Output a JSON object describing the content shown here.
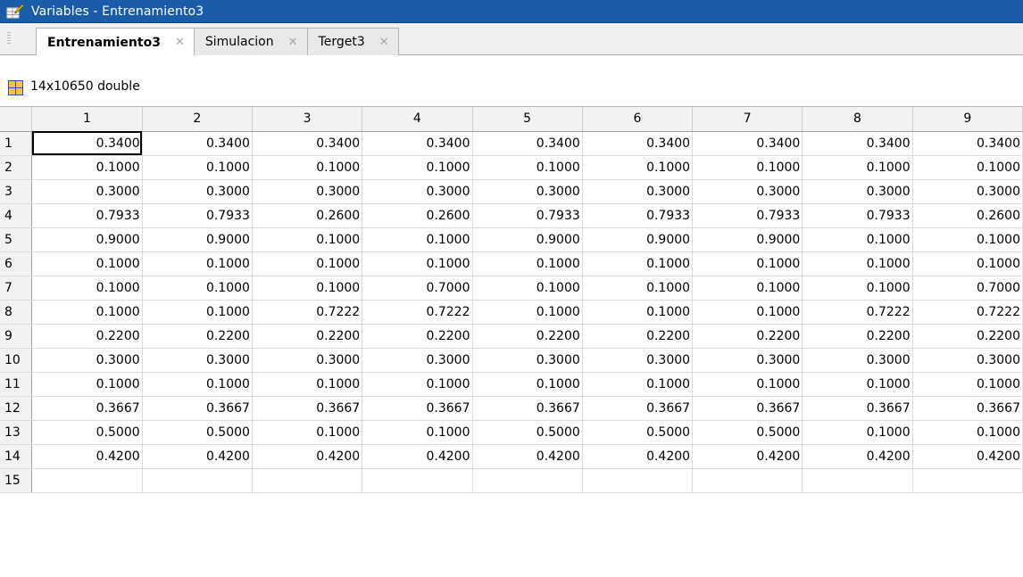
{
  "window": {
    "title": "Variables - Entrenamiento3"
  },
  "tabs": [
    {
      "label": "Entrenamiento3",
      "active": true
    },
    {
      "label": "Simulacion",
      "active": false
    },
    {
      "label": "Terget3",
      "active": false
    }
  ],
  "variable": {
    "info": "14x10650 double"
  },
  "table": {
    "columns": [
      "1",
      "2",
      "3",
      "4",
      "5",
      "6",
      "7",
      "8",
      "9"
    ],
    "rows": [
      {
        "label": "1",
        "values": [
          "0.3400",
          "0.3400",
          "0.3400",
          "0.3400",
          "0.3400",
          "0.3400",
          "0.3400",
          "0.3400",
          "0.3400"
        ]
      },
      {
        "label": "2",
        "values": [
          "0.1000",
          "0.1000",
          "0.1000",
          "0.1000",
          "0.1000",
          "0.1000",
          "0.1000",
          "0.1000",
          "0.1000"
        ]
      },
      {
        "label": "3",
        "values": [
          "0.3000",
          "0.3000",
          "0.3000",
          "0.3000",
          "0.3000",
          "0.3000",
          "0.3000",
          "0.3000",
          "0.3000"
        ]
      },
      {
        "label": "4",
        "values": [
          "0.7933",
          "0.7933",
          "0.2600",
          "0.2600",
          "0.7933",
          "0.7933",
          "0.7933",
          "0.7933",
          "0.2600"
        ]
      },
      {
        "label": "5",
        "values": [
          "0.9000",
          "0.9000",
          "0.1000",
          "0.1000",
          "0.9000",
          "0.9000",
          "0.9000",
          "0.1000",
          "0.1000"
        ]
      },
      {
        "label": "6",
        "values": [
          "0.1000",
          "0.1000",
          "0.1000",
          "0.1000",
          "0.1000",
          "0.1000",
          "0.1000",
          "0.1000",
          "0.1000"
        ]
      },
      {
        "label": "7",
        "values": [
          "0.1000",
          "0.1000",
          "0.1000",
          "0.7000",
          "0.1000",
          "0.1000",
          "0.1000",
          "0.1000",
          "0.7000"
        ]
      },
      {
        "label": "8",
        "values": [
          "0.1000",
          "0.1000",
          "0.7222",
          "0.7222",
          "0.1000",
          "0.1000",
          "0.1000",
          "0.7222",
          "0.7222"
        ]
      },
      {
        "label": "9",
        "values": [
          "0.2200",
          "0.2200",
          "0.2200",
          "0.2200",
          "0.2200",
          "0.2200",
          "0.2200",
          "0.2200",
          "0.2200"
        ]
      },
      {
        "label": "10",
        "values": [
          "0.3000",
          "0.3000",
          "0.3000",
          "0.3000",
          "0.3000",
          "0.3000",
          "0.3000",
          "0.3000",
          "0.3000"
        ]
      },
      {
        "label": "11",
        "values": [
          "0.1000",
          "0.1000",
          "0.1000",
          "0.1000",
          "0.1000",
          "0.1000",
          "0.1000",
          "0.1000",
          "0.1000"
        ]
      },
      {
        "label": "12",
        "values": [
          "0.3667",
          "0.3667",
          "0.3667",
          "0.3667",
          "0.3667",
          "0.3667",
          "0.3667",
          "0.3667",
          "0.3667"
        ]
      },
      {
        "label": "13",
        "values": [
          "0.5000",
          "0.5000",
          "0.1000",
          "0.1000",
          "0.5000",
          "0.5000",
          "0.5000",
          "0.1000",
          "0.1000"
        ]
      },
      {
        "label": "14",
        "values": [
          "0.4200",
          "0.4200",
          "0.4200",
          "0.4200",
          "0.4200",
          "0.4200",
          "0.4200",
          "0.4200",
          "0.4200"
        ]
      },
      {
        "label": "15",
        "values": [
          "",
          "",
          "",
          "",
          "",
          "",
          "",
          "",
          ""
        ]
      }
    ]
  },
  "colors": {
    "titlebar": "#1b5ca8",
    "header_bg": "#f2f2f2",
    "selection_outline": "#000000"
  },
  "icons": {
    "app": "variables-editor-icon",
    "variable": "matrix-grid-icon",
    "tab_close": "close-x-icon"
  }
}
